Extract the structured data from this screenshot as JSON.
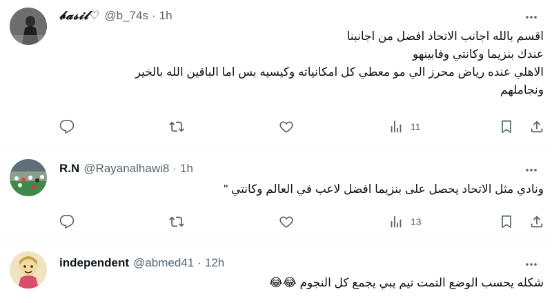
{
  "tweets": [
    {
      "display_name": "𝓫𝓪𝓼𝓲𝓵♡",
      "handle": "@b_74s",
      "time": "1h",
      "lines": [
        "اقسم بالله اجانب الاتحاد افضل من اجانبنا",
        "عندك بنزيما وكانتي وفابينهو",
        "الاهلي عنده رياض محرز الي مو معطي كل امكانياته وكيسيه بس اما الباقين الله بالخير",
        "ونجاملهم"
      ],
      "views": "11",
      "avatar_icon": "dark-figure-avatar"
    },
    {
      "display_name": "R.N",
      "handle": "@Rayanalhawi8",
      "time": "1h",
      "lines": [
        "ونادي مثل الاتحاد يحصل على بنزيما افضل لاعب في العالم وكانتي \""
      ],
      "views": "13",
      "avatar_icon": "stadium-crowd-avatar"
    },
    {
      "display_name": "independent",
      "handle": "@abmed41",
      "time": "12h",
      "lines": [
        "شكله يحسب الوضع التمت تيم يبي يجمع كل النجوم 😂😂"
      ],
      "avatar_icon": "cartoon-figure-avatar"
    }
  ],
  "separator": "·",
  "colors": {
    "text": "#0f1419",
    "secondary": "#536471",
    "divider": "#eff3f4"
  }
}
